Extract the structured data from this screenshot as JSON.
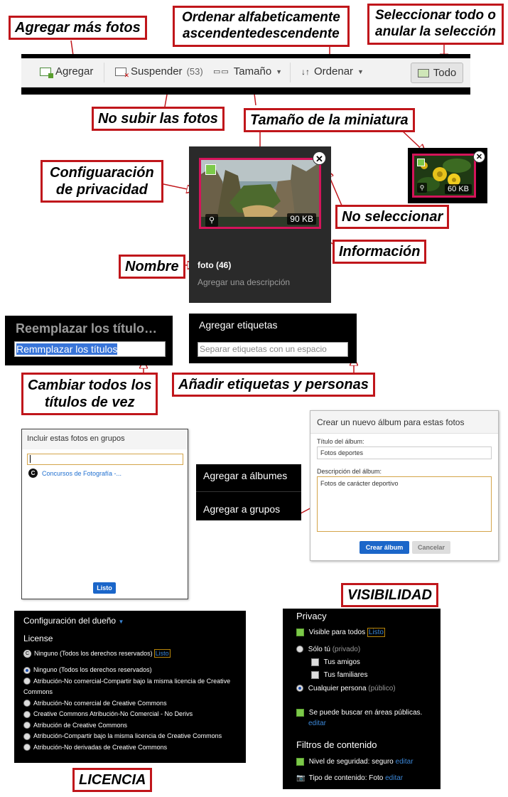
{
  "callouts": {
    "add_more": "Agregar más fotos",
    "sort_l1": "Ordenar alfabeticamente",
    "sort_l2": "ascendentedescendente",
    "select_l1": "Seleccionar todo o",
    "select_l2": "anular la selección",
    "no_upload": "No subir las fotos",
    "thumb_size": "Tamaño de la miniatura",
    "privacy_l1": "Configuaración",
    "privacy_l2": "de privacidad",
    "deselect": "No seleccionar",
    "info": "Información",
    "name": "Nombre",
    "change_titles_l1": "Cambiar todos los",
    "change_titles_l2": "títulos de vez",
    "add_tags": "Añadir etiquetas y personas",
    "visibility": "VISIBILIDAD",
    "license": "LICENCIA"
  },
  "toolbar": {
    "add_label": "Agregar",
    "suspend_label": "Suspender",
    "suspend_count": "(53)",
    "size_label": "Tamaño",
    "sort_label": "Ordenar",
    "all_label": "Todo"
  },
  "photo": {
    "size": "90 KB",
    "name": "foto (46)",
    "description_placeholder": "Agregar una descripción"
  },
  "small_photo": {
    "size": "60 KB"
  },
  "replace": {
    "heading": "Reemplazar los título…",
    "input_value": "Remmplazar los títulos"
  },
  "tags": {
    "heading": "Agregar etiquetas",
    "placeholder": "Separar etiquetas con un espacio"
  },
  "groups": {
    "title": "Incluir estas fotos en grupos",
    "item": "Concursos de Fotografía -...",
    "done": "Listo"
  },
  "albums_menu": {
    "add_albums": "Agregar a álbumes",
    "add_groups": "Agregar a grupos"
  },
  "album_form": {
    "heading": "Crear un nuevo álbum para estas fotos",
    "title_label": "Título del álbum:",
    "title_value": "Fotos deportes",
    "desc_label": "Descripción del álbum:",
    "desc_value": "Fotos de carácter deportivo",
    "create": "Crear álbum",
    "cancel": "Cancelar"
  },
  "license_panel": {
    "owner": "Configuración del dueño",
    "license": "License",
    "current": "Ninguno (Todos los derechos reservados)",
    "done": "Listo",
    "options": [
      "Ninguno (Todos los derechos reservados)",
      "Atribución-No comercial-Compartir bajo la misma licencia de Creative Commons",
      "Atribución-No comercial de Creative Commons",
      "Creative Commons Atribución-No Comercial - No Derivs",
      "Atribución de Creative Commons",
      "Atribución-Compartir bajo la misma licencia de Creative Commons",
      "Atribución-No derivadas de Creative Commons"
    ]
  },
  "privacy_panel": {
    "title": "Privacy",
    "visible_all": "Visible para todos",
    "done": "Listo",
    "only_you": "Sólo tú",
    "private": "(privado)",
    "friends": "Tus amigos",
    "family": "Tus familiares",
    "anyone": "Cualquier persona",
    "public": "(público)",
    "searchable": "Se puede buscar en áreas públicas.",
    "edit": "editar",
    "filters": "Filtros de contenido",
    "safety": "Nivel de seguridad: seguro",
    "content_type": "Tipo de contenido: Foto"
  }
}
